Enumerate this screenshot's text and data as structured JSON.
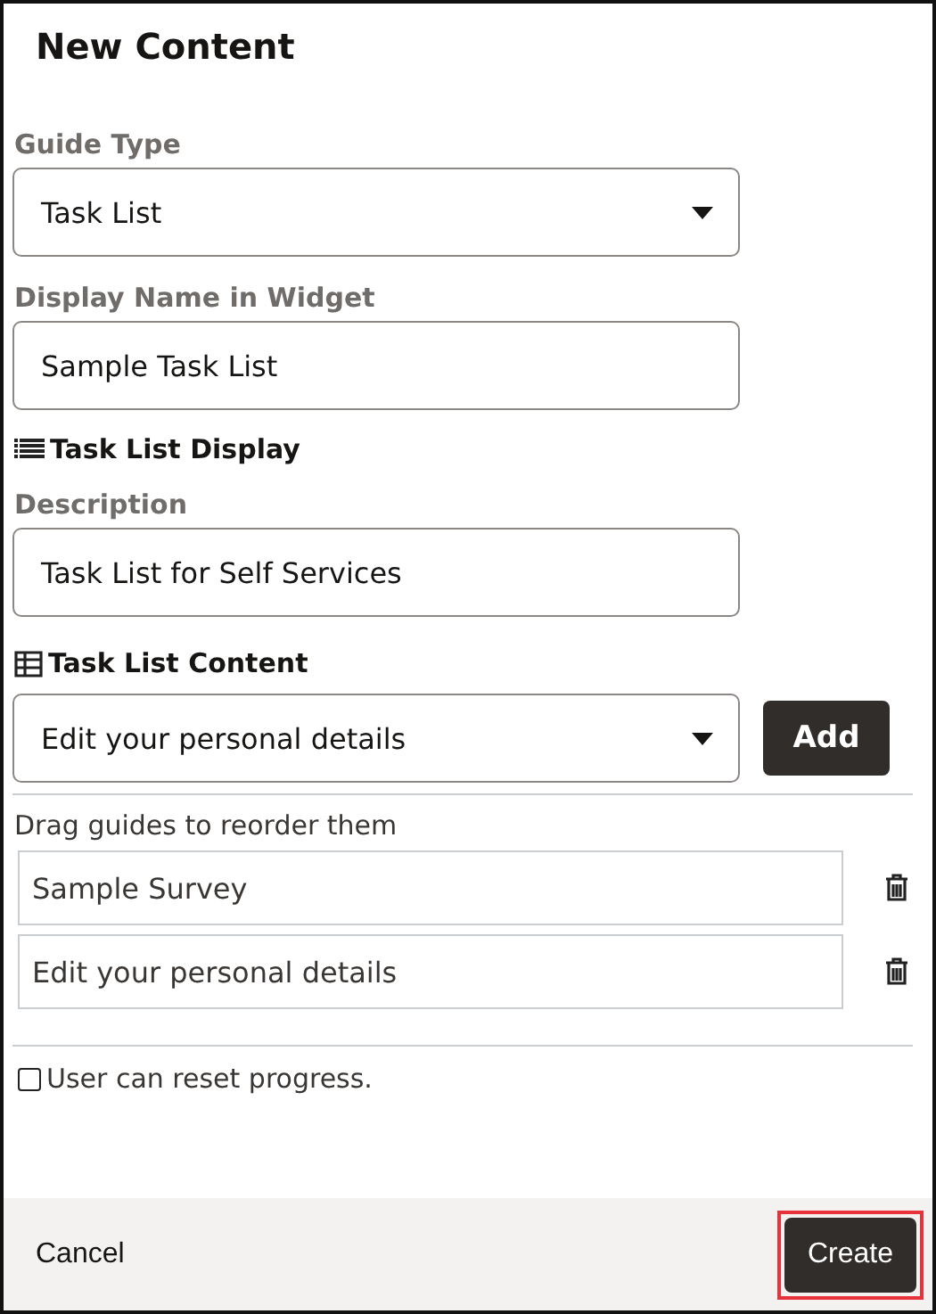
{
  "title": "New Content",
  "guide_type": {
    "label": "Guide Type",
    "value": "Task List"
  },
  "display_name": {
    "label": "Display Name in Widget",
    "value": "Sample Task List"
  },
  "task_list_display": {
    "heading": "Task List Display"
  },
  "description": {
    "label": "Description",
    "value": "Task List for Self Services"
  },
  "task_list_content": {
    "heading": "Task List Content",
    "value": "Edit your personal details",
    "add_button": "Add"
  },
  "reorder_hint": "Drag guides to reorder them",
  "guides": [
    {
      "name": "Sample Survey"
    },
    {
      "name": "Edit your personal details"
    }
  ],
  "reset_progress": {
    "label": "User can reset progress.",
    "checked": false
  },
  "footer": {
    "cancel": "Cancel",
    "create": "Create",
    "create_highlighted": true
  }
}
